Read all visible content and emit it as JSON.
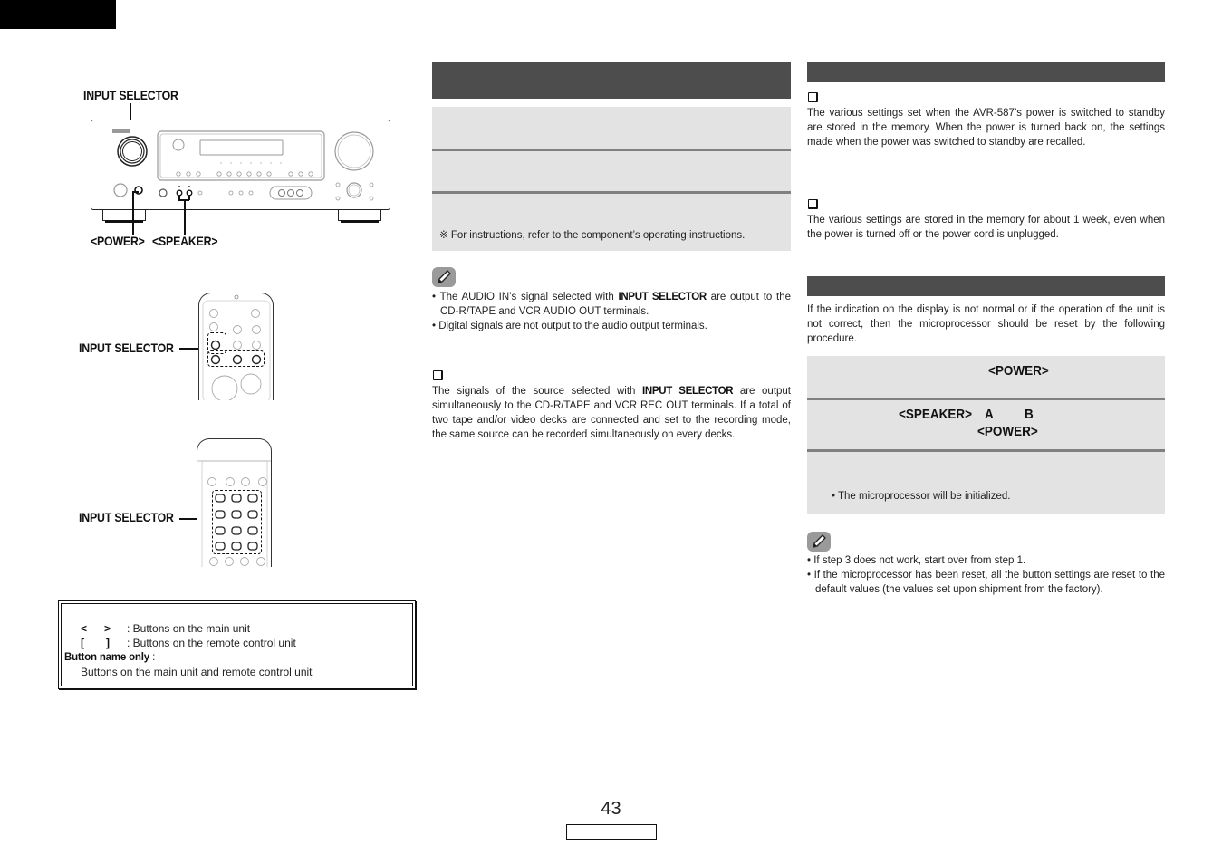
{
  "page": {
    "number": "43"
  },
  "left": {
    "main_unit": {
      "input_selector_label": "INPUT SELECTOR",
      "power_label": "<POWER>",
      "speaker_label": "<SPEAKER>"
    },
    "remote_1": {
      "input_selector_label": "INPUT SELECTOR"
    },
    "remote_2": {
      "input_selector_label": "INPUT SELECTOR"
    },
    "legend": {
      "rows": [
        {
          "symbol_open": "<",
          "symbol_close": ">",
          "text": ": Buttons on the main unit"
        },
        {
          "symbol_open": "[",
          "symbol_close": "]",
          "text": ": Buttons on the remote control unit"
        }
      ],
      "button_name_only_label": "Button name only",
      "button_name_only_colon": " :",
      "button_name_only_text": "Buttons on the main unit and remote control unit"
    }
  },
  "middle": {
    "steps_footnote": "※  For instructions, refer to the component’s operating instructions.",
    "note_icon": "pencil-icon",
    "notes": [
      {
        "pre": "The AUDIO IN’s signal selected with ",
        "bold": "INPUT SELECTOR",
        "post": " are output to the CD-R/TAPE and VCR AUDIO OUT terminals."
      },
      {
        "pre": "Digital signals are not output to the audio output terminals.",
        "bold": "",
        "post": ""
      }
    ],
    "section_icon": "checkbox-icon",
    "section_para": {
      "pre": "The signals of the source selected with ",
      "bold": "INPUT SELECTOR",
      "post": " are output simultaneously to the CD-R/TAPE and VCR REC OUT terminals. If a total of two tape and/or video decks are connected and set to the recording mode, the same source can be recorded simultaneously on every decks."
    }
  },
  "right": {
    "memory_section_1": "The various settings set when the AVR-587’s power is switched to standby are stored in the memory. When the power is turned back on, the settings made when the power was switched to standby are recalled.",
    "memory_section_2": "The various settings are stored in the memory for about 1 week, even when the power is turned off or the power cord is unplugged.",
    "reset_intro": "If the indication on the display is not normal or if the operation of the unit is not correct, then the microprocessor should be reset by the following procedure.",
    "reset_steps": {
      "step1_power": "<POWER>",
      "step2_speaker": "<SPEAKER>",
      "step2_a": "A",
      "step2_b": "B",
      "step2_power": "<POWER>",
      "step3_bullet": "The microprocessor will be initialized."
    },
    "notes": [
      "If step 3 does not work, start over from step 1.",
      "If the microprocessor has been reset, all the button settings are reset to the default values (the values set upon shipment from the factory)."
    ]
  },
  "colors": {
    "header_bar": "#4d4d4d",
    "step_box": "#e3e3e3",
    "step_separator": "#808080",
    "note_icon_bg": "#9a9a9a"
  }
}
